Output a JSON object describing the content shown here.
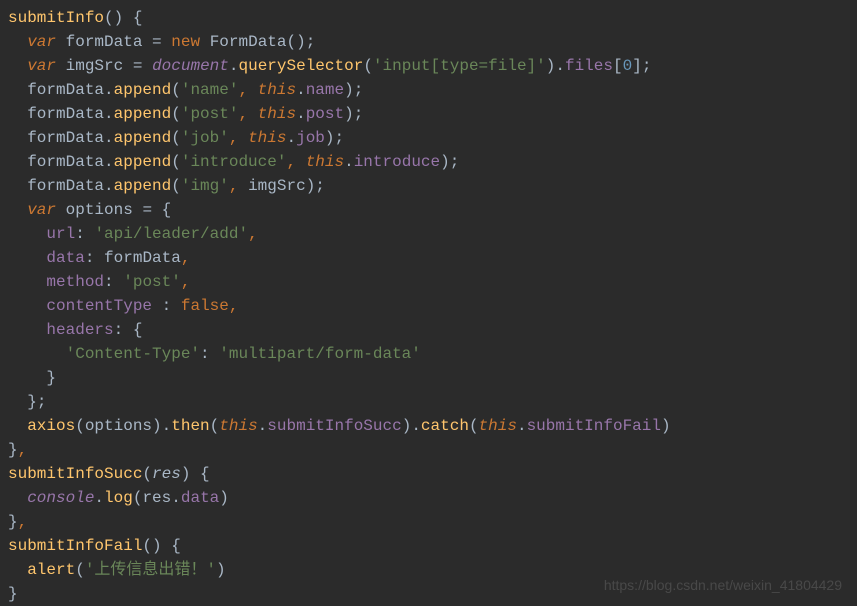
{
  "code": {
    "l1_fn": "submitInfo",
    "l2_var": "var",
    "l2_name": "formData",
    "l2_new": "new",
    "l2_type": "FormData",
    "l3_var": "var",
    "l3_name": "imgSrc",
    "l3_doc": "document",
    "l3_qs": "querySelector",
    "l3_sel": "'input[type=file]'",
    "l3_files": "files",
    "l3_idx": "0",
    "l4_append": "append",
    "l4_name_str": "'name'",
    "l4_this": "this",
    "l4_name_prop": "name",
    "l5_post_str": "'post'",
    "l5_post_prop": "post",
    "l6_job_str": "'job'",
    "l6_job_prop": "job",
    "l7_intro_str": "'introduce'",
    "l7_intro_prop": "introduce",
    "l8_img_str": "'img'",
    "l8_imgsrc": "imgSrc",
    "l9_var": "var",
    "l9_options": "options",
    "l10_url": "url",
    "l10_url_val": "'api/leader/add'",
    "l11_data": "data",
    "l11_data_val": "formData",
    "l12_method": "method",
    "l12_method_val": "'post'",
    "l13_ct": "contentType",
    "l13_false": "false",
    "l14_headers": "headers",
    "l15_ct_key": "'Content-Type'",
    "l15_ct_val": "'multipart/form-data'",
    "l18_axios": "axios",
    "l18_then": "then",
    "l18_succ": "submitInfoSucc",
    "l18_catch": "catch",
    "l18_fail": "submitInfoFail",
    "l20_fn": "submitInfoSucc",
    "l20_res": "res",
    "l21_console": "console",
    "l21_log": "log",
    "l21_data": "data",
    "l23_fn": "submitInfoFail",
    "l24_alert": "alert",
    "l24_msg": "'上传信息出错！'"
  },
  "watermark": "https://blog.csdn.net/weixin_41804429"
}
